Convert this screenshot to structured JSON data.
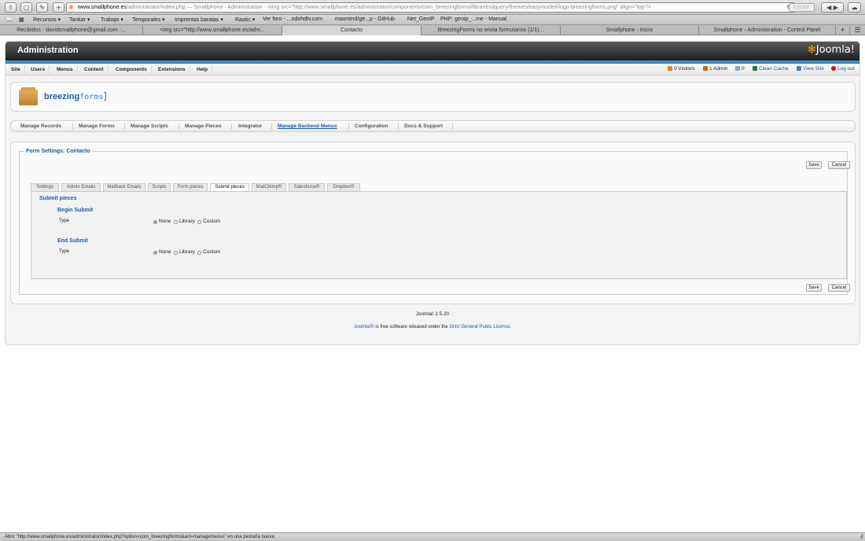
{
  "browser": {
    "url_host": "www.smallphone.es",
    "url_rest": "/administrator/index.php",
    "page_title": "Smallphone - Administration - <img src=\"http://www.smallphone.es/administrator/components/com_breezingforms/libraries/jquery/themes/easymode/i/logo-breezingforms.png\" align=\"top\"/>",
    "reader_label": "Lector",
    "bookmarks": [
      "Recursos ▾",
      "Tankar ▾",
      "Trabajo ▾",
      "Temporales ▾",
      "Imprentas baratas ▾",
      "Raatic ▾",
      "Ver foro - ...odohdtv.com",
      "maxmind/ge...p - GitHub",
      "Net_GeoIP",
      "PHP: geoip_...me - Manual"
    ],
    "tabs": [
      "Recibidos - davidsmallphone@gmail.com -...",
      "<img src=\"http://www.smallphone.es/adm...",
      "Contacto",
      "BreezingForms no envia formularios (1/1)...",
      "Smallphone - Inicio",
      "Smallphone - Administration - Control Panel"
    ],
    "status_text": "Abrir \"http://www.smallphone.es/administrator/index.php?option=com_breezingforms&act=managemenus\" en una pestaña nueva"
  },
  "admin": {
    "header_title": "Administration",
    "logo_text": "Joomla!",
    "menu": [
      "Site",
      "Users",
      "Menus",
      "Content",
      "Components",
      "Extensions",
      "Help"
    ],
    "status": {
      "visitors": "0 Visitors",
      "admin": "1 Admin",
      "messages": "0",
      "clean_cache": "Clean Cache",
      "view_site": "View Site",
      "logout": "Log out"
    }
  },
  "component": {
    "logo_bold": "breezing",
    "logo_light": "forms"
  },
  "subnav": [
    "Manage Records",
    "Manage Forms",
    "Manage Scripts",
    "Manage Pieces",
    "Integrator",
    "Manage Backend Menus",
    "Configuration",
    "Docs & Support"
  ],
  "subnav_active": "Manage Backend Menus",
  "form": {
    "legend": "Form Settings: Contacto",
    "save": "Save",
    "cancel": "Cancel",
    "tabs": [
      "Settings",
      "Admin Emails",
      "Mailback Emails",
      "Scripts",
      "Form pieces",
      "Submit pieces",
      "MailChimp®",
      "Salesforce®",
      "Dropbox®"
    ],
    "active_tab": "Submit pieces",
    "section_title": "Submit pieces",
    "begin_title": "Begin Submit",
    "end_title": "End Submit",
    "type_label": "Type",
    "options": [
      "None",
      "Library",
      "Custom"
    ],
    "begin_selected": "None",
    "end_selected": "None"
  },
  "footer": {
    "version": "Joomla! 2.5.20",
    "license_link1": "Joomla!®",
    "license_mid": " is free software released under the ",
    "license_link2": "GNU General Public License",
    "license_end": "."
  }
}
